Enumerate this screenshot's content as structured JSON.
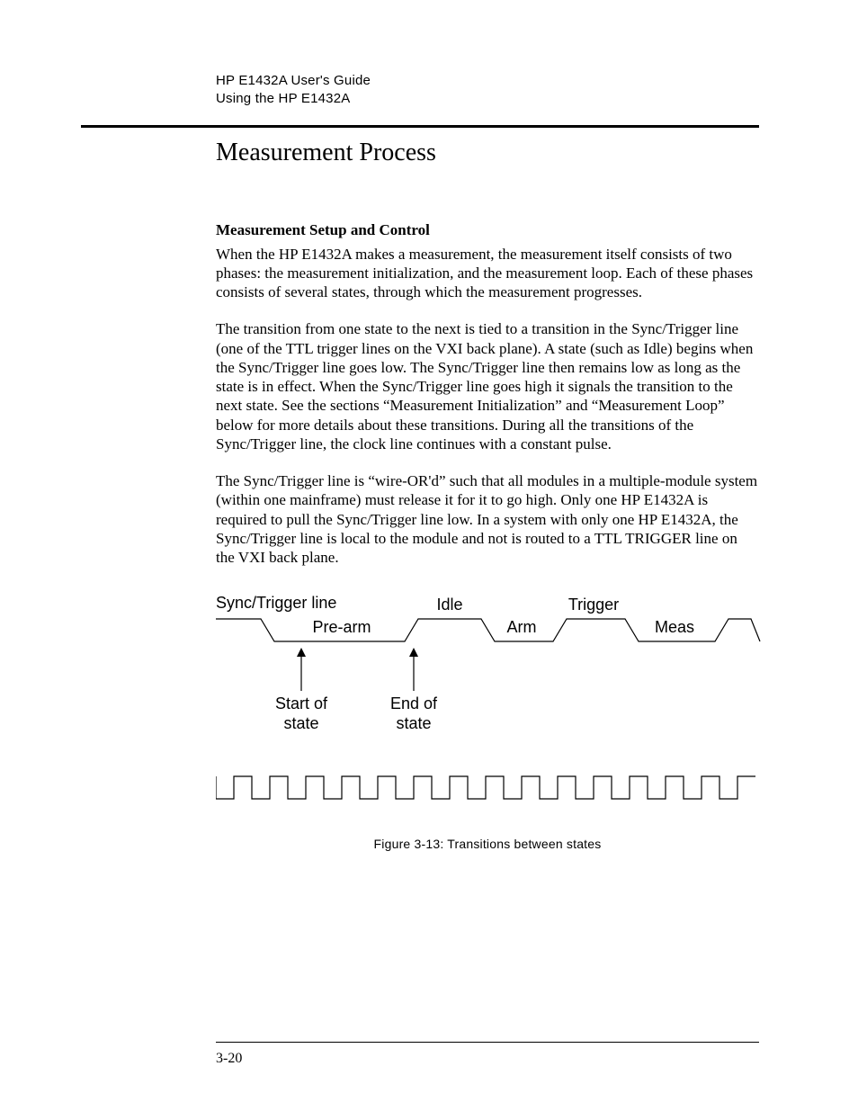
{
  "header": {
    "line1": "HP E1432A User's Guide",
    "line2": "Using the HP E1432A"
  },
  "title": "Measurement Process",
  "subhead": "Measurement Setup and Control",
  "paragraphs": {
    "p1": "When the HP E1432A makes a measurement, the measurement itself consists of two phases:  the measurement initialization, and the measurement loop.  Each of these phases consists of several states, through which the measurement progresses.",
    "p2": "The transition from one state to the next is tied to a transition in the Sync/Trigger line (one of the TTL trigger lines on the VXI back plane).  A state (such as Idle) begins when the Sync/Trigger line goes low.  The Sync/Trigger line then remains low as long as the state is in effect.  When the Sync/Trigger line goes high it signals the transition to the next state.  See the sections “Measurement Initialization” and “Measurement Loop” below for more details about these transitions.  During all the transitions of the Sync/Trigger line, the clock line continues with a constant pulse.",
    "p3": "The Sync/Trigger line is “wire-OR'd” such that all modules in a multiple-module system (within one mainframe) must release it for it to go high.  Only one HP E1432A is required to pull the Sync/Trigger line low.  In a system with only one HP E1432A, the Sync/Trigger line is local to the module and not is routed to a TTL TRIGGER line on the VXI back plane."
  },
  "figure": {
    "labels": {
      "sync": "Sync/Trigger line",
      "idle": "Idle",
      "trigger": "Trigger",
      "prearm": "Pre-arm",
      "arm": "Arm",
      "meas": "Meas",
      "start": "Start of\nstate",
      "end": "End of\nstate"
    },
    "caption": "Figure 3-13:  Transitions between states"
  },
  "page_number": "3-20"
}
